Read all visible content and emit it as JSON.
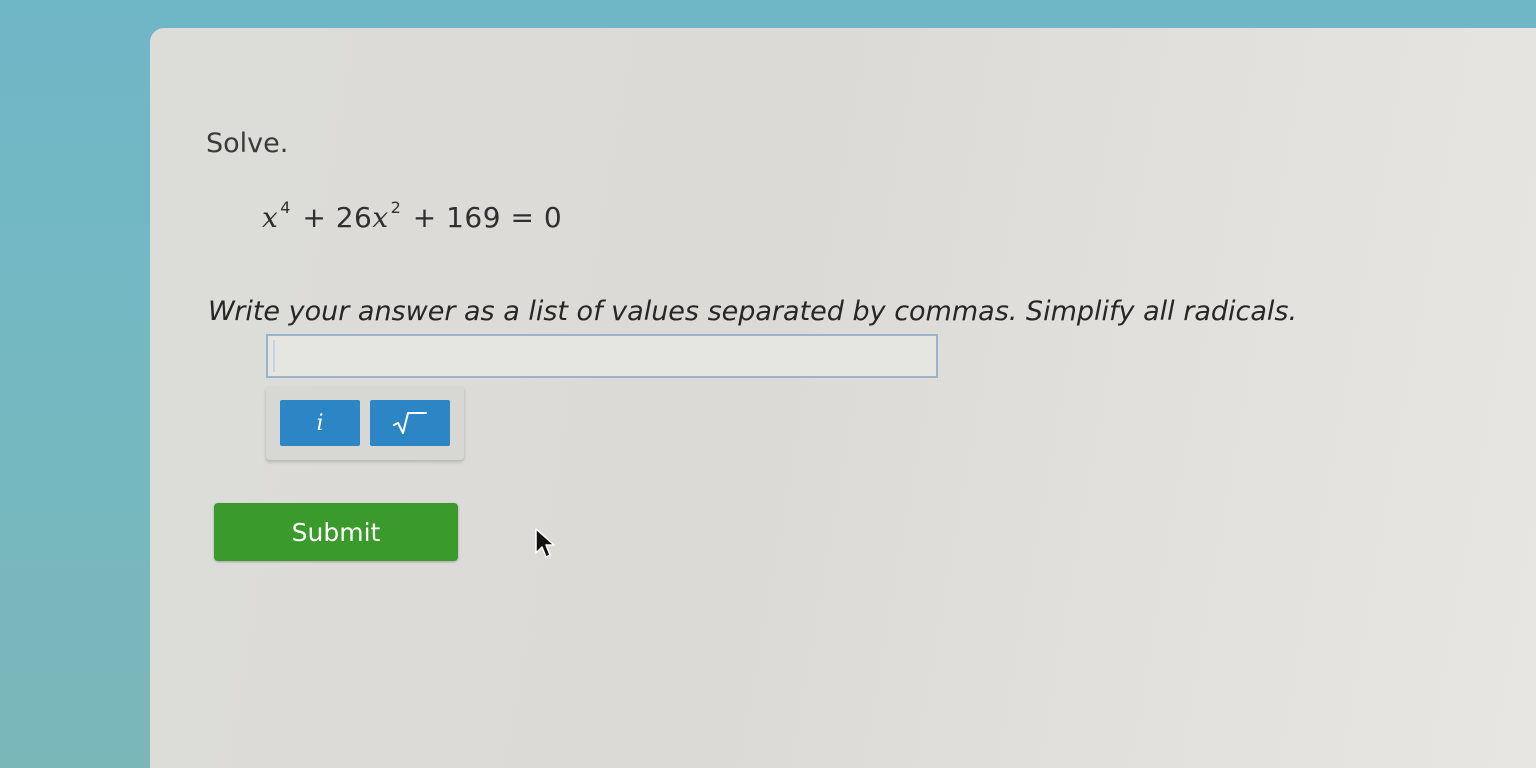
{
  "question": {
    "instruction": "Solve.",
    "equation": {
      "variable": "x",
      "exp1": "4",
      "middle": " + 26",
      "exp2": "2",
      "tail": " + 169 = 0"
    },
    "prompt": "Write your answer as a list of values separated by commas. Simplify all radicals."
  },
  "answer": {
    "value": "",
    "placeholder": ""
  },
  "toolbar": {
    "imaginary_label": "i",
    "sqrt_icon": "square-root-icon"
  },
  "actions": {
    "submit_label": "Submit"
  },
  "colors": {
    "background": "#74b8c3",
    "panel": "#dcdad6",
    "tool_button": "#2c86c6",
    "submit": "#3b9a2c",
    "input_border": "#9bb3c7"
  }
}
